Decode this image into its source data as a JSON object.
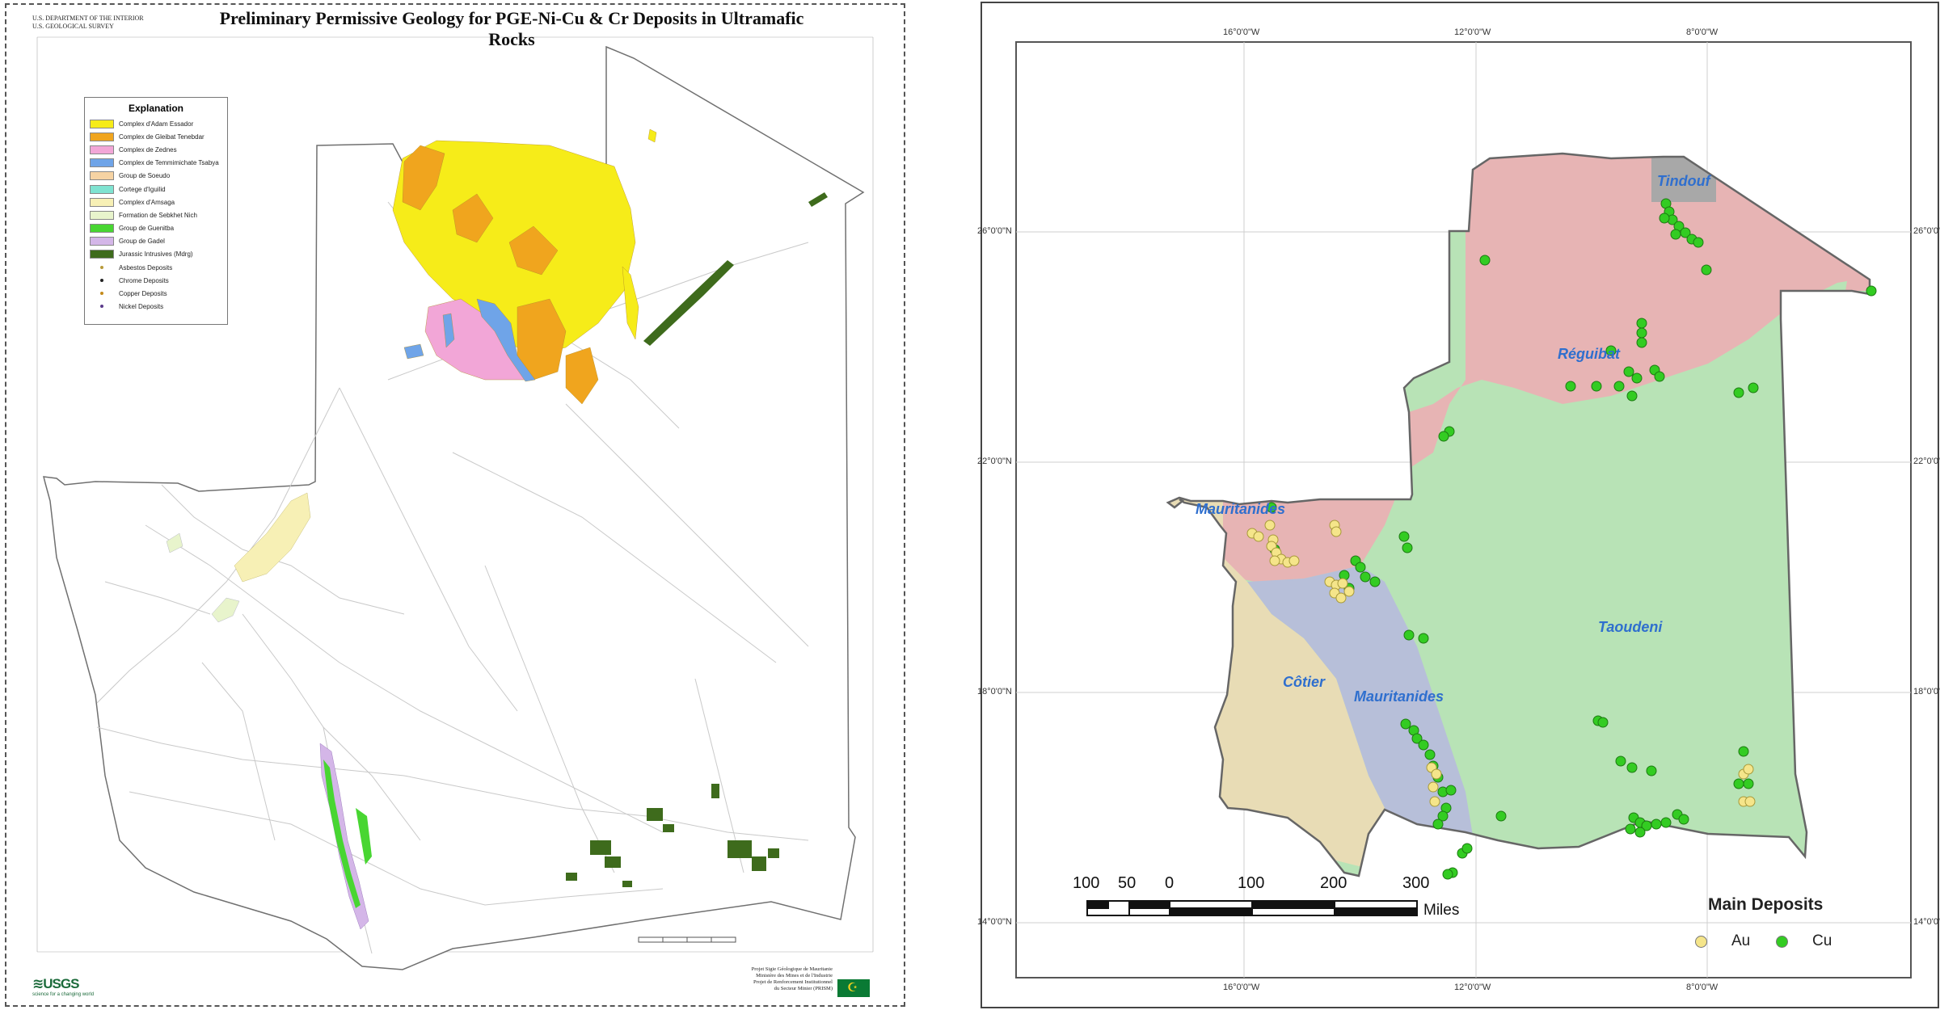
{
  "left_map": {
    "agency_lines": [
      "U.S. DEPARTMENT OF THE INTERIOR",
      "U.S. GEOLOGICAL SURVEY"
    ],
    "title": "Preliminary Permissive Geology for PGE-Ni-Cu & Cr Deposits in Ultramafic Rocks",
    "legend": {
      "title": "Explanation",
      "units": [
        {
          "label": "Complex d'Adam Essador",
          "color": "#f6ec19"
        },
        {
          "label": "Complex de Gleibat Tenebdar",
          "color": "#f0a51e"
        },
        {
          "label": "Complex de Zednes",
          "color": "#f2a6d7"
        },
        {
          "label": "Complex de Temmimichate Tsabya",
          "color": "#6fa4e8"
        },
        {
          "label": "Group de Soeudo",
          "color": "#f6d3a3"
        },
        {
          "label": "Cortege d'Iguilid",
          "color": "#7fe3d1"
        },
        {
          "label": "Complex d'Amsaga",
          "color": "#f7f0b5"
        },
        {
          "label": "Formation de Sebkhet Nich",
          "color": "#e8f4cc"
        },
        {
          "label": "Group de Guenitba",
          "color": "#48d632"
        },
        {
          "label": "Group de Gadel",
          "color": "#d4b6e8"
        },
        {
          "label": "Jurassic Intrusives (Mdrg)",
          "color": "#3e6b1c"
        }
      ],
      "deposits": [
        {
          "label": "Asbestos Deposits",
          "color": "#b89a3a"
        },
        {
          "label": "Chrome Deposits",
          "color": "#222222"
        },
        {
          "label": "Copper Deposits",
          "color": "#c48a1a"
        },
        {
          "label": "Nickel Deposits",
          "color": "#5a3a8a"
        }
      ]
    },
    "usgs_logo": "≋USGS",
    "usgs_tagline": "science for a changing world",
    "partner_lines": [
      "Projet Sigie Géologique de Mauritanie",
      "Ministère des Mines et de l'Industrie",
      "Projet de Renforcement Institutionnel",
      "du Secteur Minier (PRISM)"
    ]
  },
  "right_map": {
    "region_labels": [
      "Tindouf",
      "Réguibat",
      "Mauritanides",
      "Taoudeni",
      "Côtier",
      "Mauritanides"
    ],
    "lon_labels": [
      "16°0'0\"W",
      "12°0'0\"W",
      "8°0'0\"W"
    ],
    "lat_labels": [
      "26°0'0\"N",
      "22°0'0\"N",
      "18°0'0\"N",
      "14°0'0\"N"
    ],
    "scale": {
      "ticks": [
        "100",
        "50",
        "0",
        "100",
        "200",
        "300"
      ],
      "unit": "Miles"
    },
    "deposits_legend": {
      "title": "Main Deposits",
      "items": [
        {
          "label": "Au",
          "color": "#f5e58a"
        },
        {
          "label": "Cu",
          "color": "#33cc22"
        }
      ]
    },
    "colors": {
      "reguibat": "#e7b4b4",
      "taoudeni": "#b8e3b6",
      "cotier": "#e8dcb5",
      "mauritanides": "#b7bfd9",
      "tindouf": "#a8a8a8"
    }
  }
}
